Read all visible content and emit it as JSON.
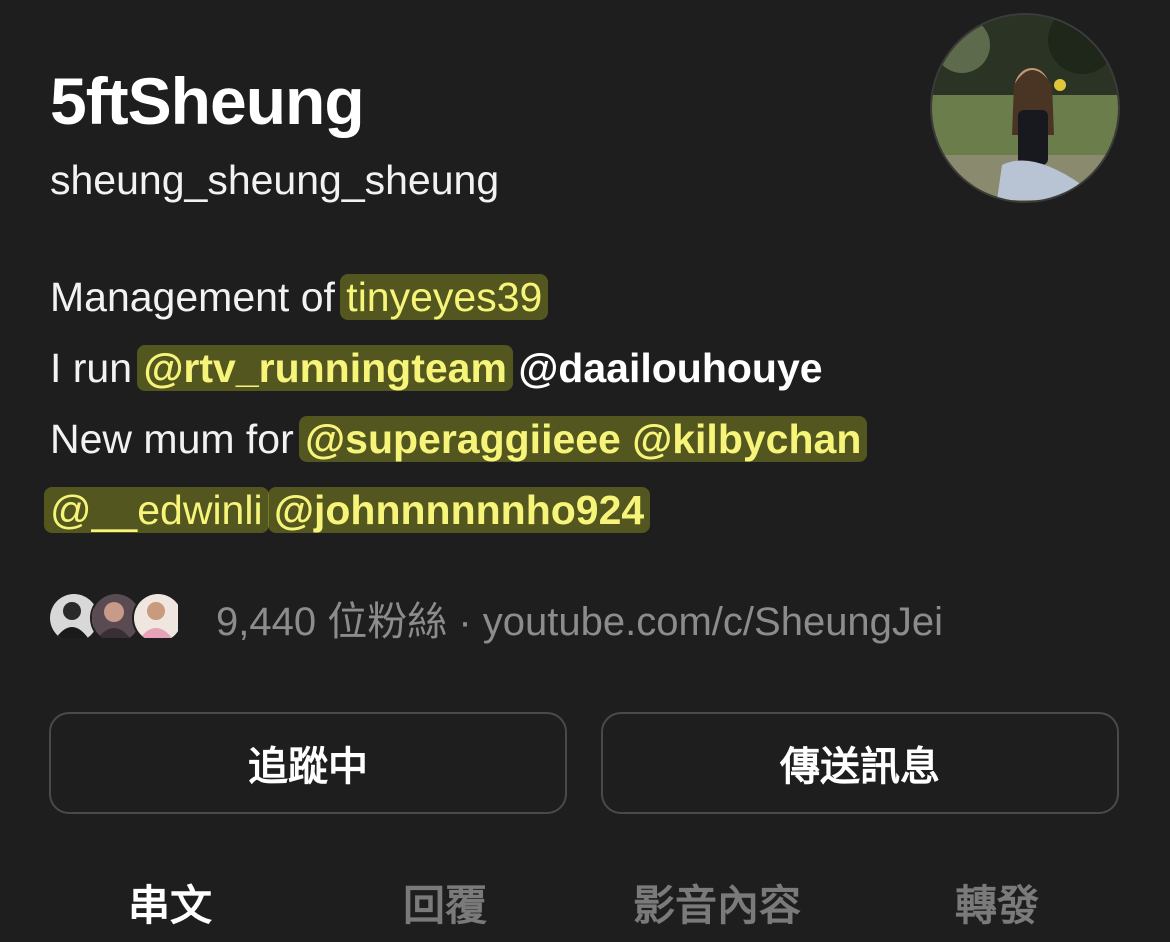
{
  "profile": {
    "display_name": "5ftSheung",
    "username": "sheung_sheung_sheung"
  },
  "bio": {
    "line1_prefix": "Management of ",
    "line1_highlight": "tinyeyes39",
    "line2_prefix": "I run ",
    "line2_mention1": "@rtv_runningteam",
    "line2_mention2": "@daailouhouye",
    "line3_prefix": "New mum for ",
    "line3_mentions": "@superaggiieee @kilbychan",
    "line4_mention1": "@__edwinli",
    "line4_mention2": "@johnnnnnnho924"
  },
  "followers": {
    "count_text": "9,440 位粉絲",
    "separator": " · ",
    "link": "youtube.com/c/SheungJei"
  },
  "actions": {
    "follow_label": "追蹤中",
    "message_label": "傳送訊息"
  },
  "tabs": [
    {
      "label": "串文",
      "active": true
    },
    {
      "label": "回覆",
      "active": false
    },
    {
      "label": "影音內容",
      "active": false
    },
    {
      "label": "轉發",
      "active": false
    }
  ],
  "colors": {
    "background": "#1e1e1e",
    "highlight": "#f6f57a",
    "muted_text": "#8c8c8c",
    "inactive_tab": "#7a7a7a"
  }
}
